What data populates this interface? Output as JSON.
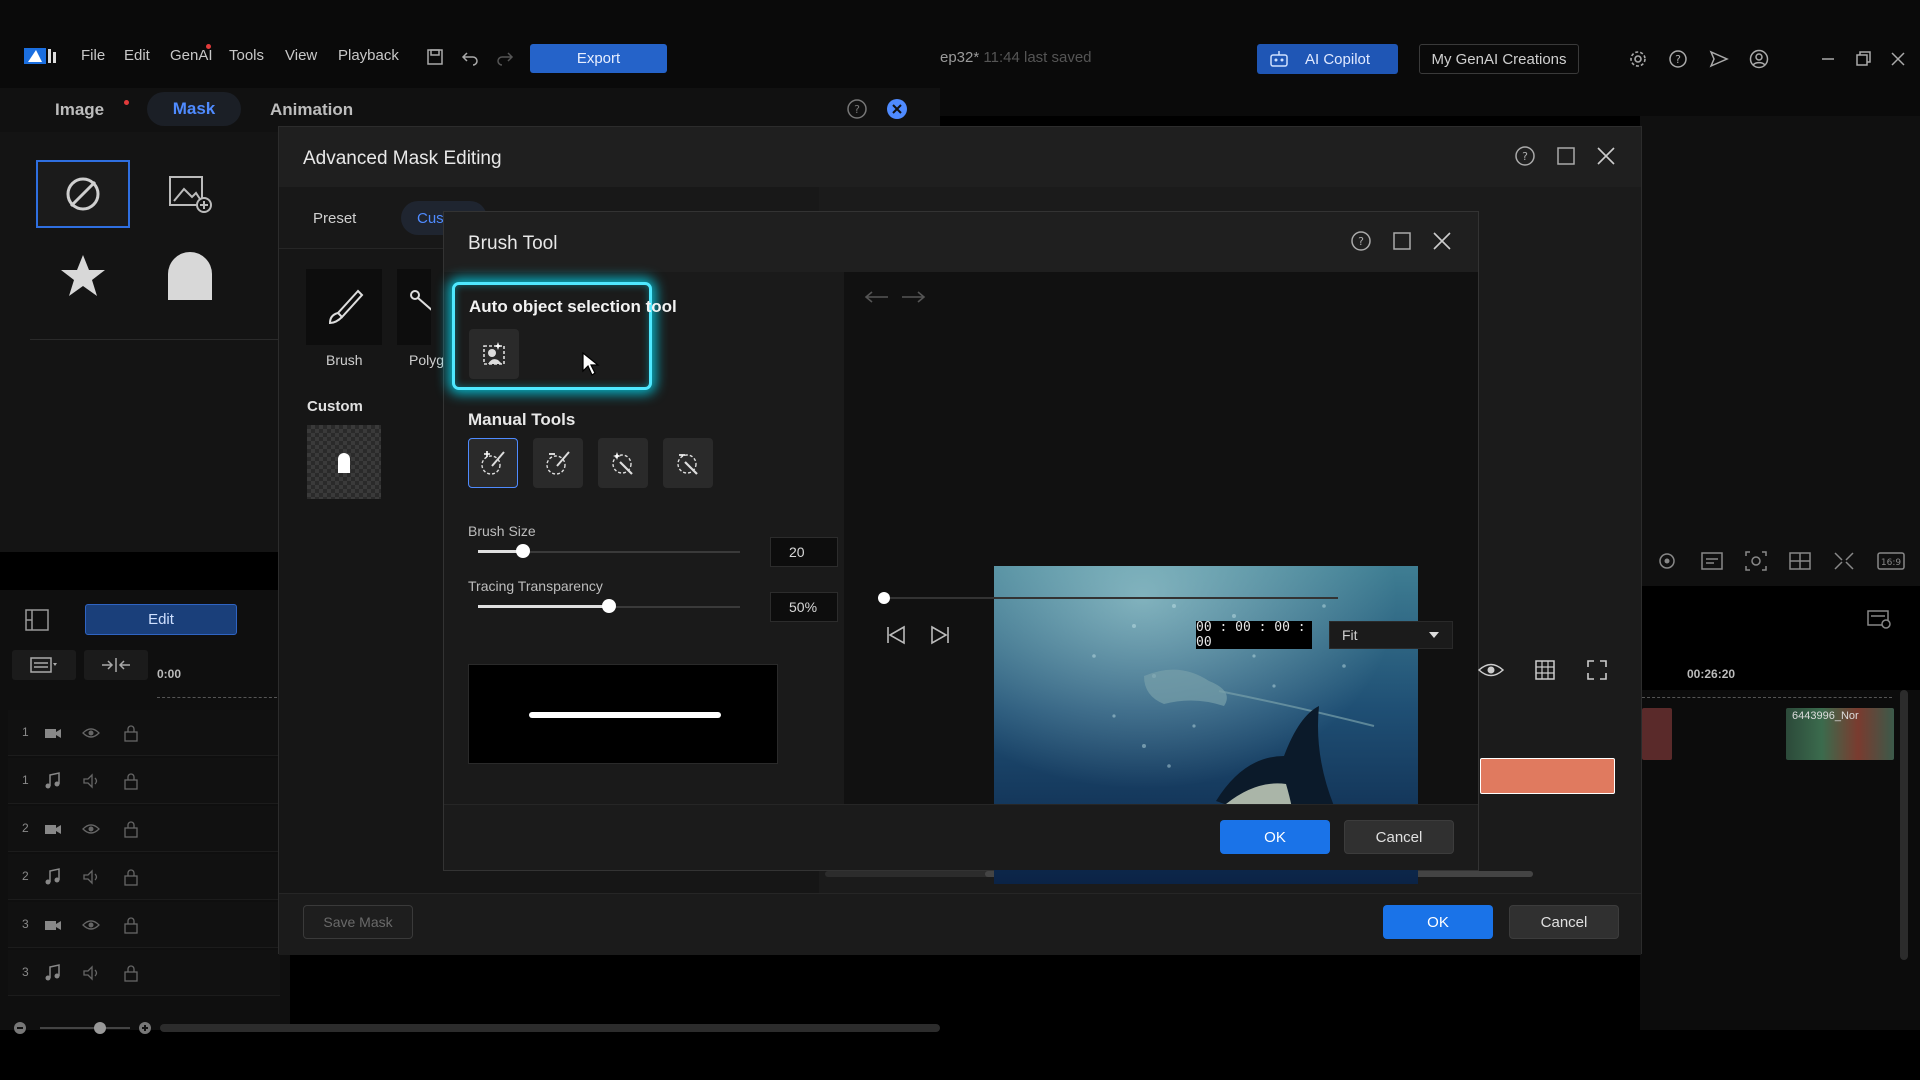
{
  "topbar": {
    "menu": [
      "File",
      "Edit",
      "GenAI",
      "Tools",
      "View",
      "Playback"
    ],
    "export_label": "Export",
    "project_name": "ep32*",
    "saved_status": "11:44 last saved",
    "copilot_label": "AI Copilot",
    "creations_label": "My GenAI Creations"
  },
  "tabs": {
    "image": "Image",
    "mask": "Mask",
    "animation": "Animation"
  },
  "left_panel": {
    "edit_label": "Edit"
  },
  "tracks": [
    "1",
    "1",
    "2",
    "2",
    "3",
    "3"
  ],
  "timeline": {
    "start_time": "0:00",
    "mid_time": "00:26:20",
    "clip_name": "6443996_Nor"
  },
  "advanced_mask": {
    "title": "Advanced Mask Editing",
    "tab_preset": "Preset",
    "tab_custom": "Cus",
    "brush_label": "Brush",
    "polygon_label": "Polyg",
    "custom_heading": "Custom",
    "save_mask_label": "Save Mask",
    "ok_label": "OK",
    "cancel_label": "Cancel"
  },
  "brush_tool": {
    "title": "Brush Tool",
    "auto_section": "Auto object selection tool",
    "manual_section": "Manual Tools",
    "brush_size_label": "Brush Size",
    "brush_size_value": "20",
    "brush_size_fraction": 0.17,
    "tracing_label": "Tracing Transparency",
    "tracing_value": "50%",
    "tracing_fraction": 0.5,
    "timecode": "00 : 00 : 00 : 00",
    "zoom_option": "Fit",
    "ok_label": "OK",
    "cancel_label": "Cancel"
  },
  "colors": {
    "accent": "#1a73e8",
    "highlight": "#4fe8ff",
    "clip": "#e07a5f"
  }
}
